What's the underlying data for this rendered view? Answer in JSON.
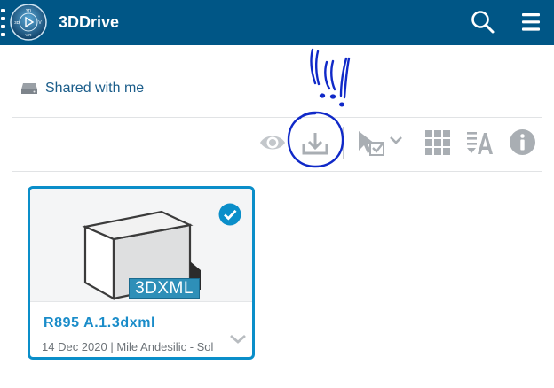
{
  "header": {
    "app_title": "3DDrive",
    "logo_text": {
      "top": "3D",
      "left": "3D",
      "right": "V",
      "bottom": "V,R"
    }
  },
  "location": {
    "label": "Shared with me",
    "icon": "drive-icon"
  },
  "toolbar": {
    "buttons": [
      {
        "name": "eye-icon",
        "action": "preview"
      },
      {
        "name": "download-icon",
        "action": "download"
      },
      {
        "name": "select-cursor-icon",
        "action": "select"
      },
      {
        "name": "grid-view-icon",
        "action": "grid view"
      },
      {
        "name": "sort-icon",
        "action": "sort"
      },
      {
        "name": "info-icon",
        "action": "info"
      }
    ]
  },
  "tile": {
    "name": "R895 A.1.3dxml",
    "meta": "14 Dec 2020 | Mile Andesilic - Sol",
    "badge": "3DXML",
    "selected": true
  },
  "colors": {
    "header_bg": "#005686",
    "accent": "#0a8ec9",
    "link": "#1b5d8a",
    "icon_gray": "#a9aeb3",
    "annotation": "#1029c8"
  },
  "annotation": {
    "description_marks": [
      "exclamation-mark",
      "exclamation-mark",
      "exclamation-mark",
      "circle-around-download"
    ]
  }
}
